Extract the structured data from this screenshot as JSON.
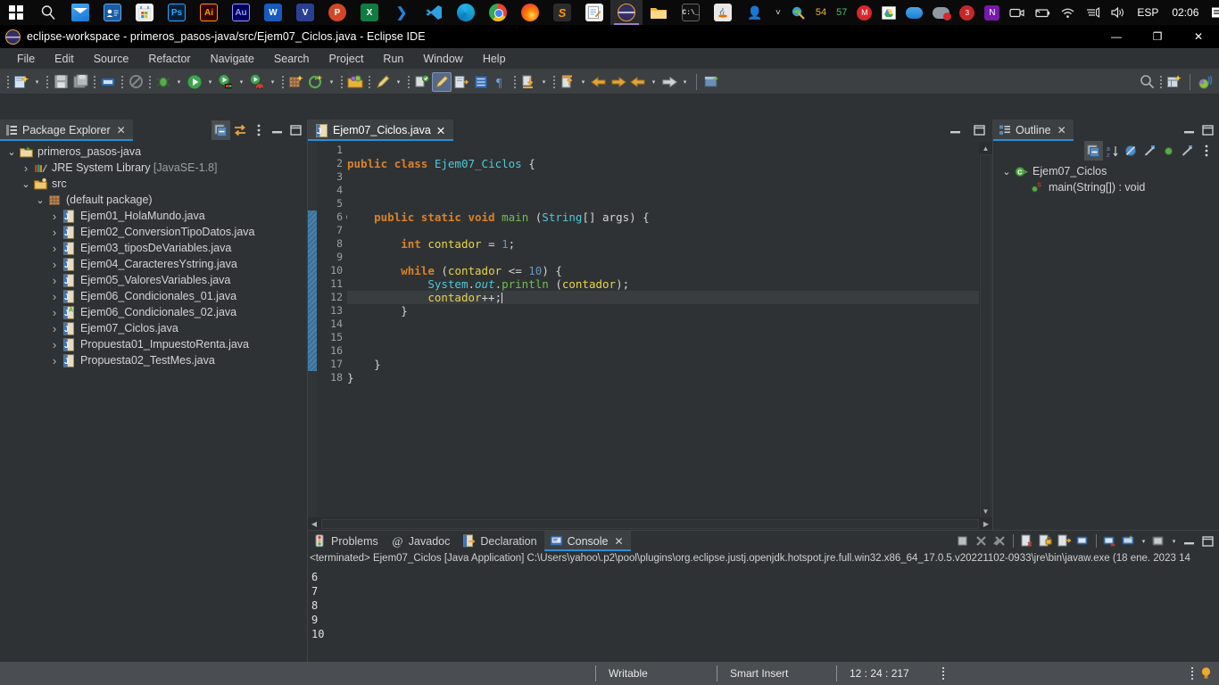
{
  "taskbar": {
    "left_items": [
      {
        "name": "start-button",
        "label": "Start"
      },
      {
        "name": "search-icon",
        "label": "Search"
      },
      {
        "name": "mail-icon",
        "label": "Mail"
      },
      {
        "name": "people-icon",
        "label": "People"
      },
      {
        "name": "microsoft-store-icon",
        "label": "Microsoft Store"
      },
      {
        "name": "photoshop-icon",
        "label": "Ps"
      },
      {
        "name": "illustrator-icon",
        "label": "Ai"
      },
      {
        "name": "audition-icon",
        "label": "Au"
      },
      {
        "name": "word-icon",
        "label": "W"
      },
      {
        "name": "visio-icon",
        "label": "V"
      },
      {
        "name": "powerpoint-icon",
        "label": "P"
      },
      {
        "name": "excel-icon",
        "label": "X"
      },
      {
        "name": "chevron-right-icon",
        "label": ""
      },
      {
        "name": "vscode-icon",
        "label": ""
      },
      {
        "name": "edge-icon",
        "label": ""
      },
      {
        "name": "chrome-icon",
        "label": ""
      },
      {
        "name": "firefox-icon",
        "label": ""
      },
      {
        "name": "sublime-icon",
        "label": ""
      },
      {
        "name": "notepad-icon",
        "label": ""
      },
      {
        "name": "eclipse-icon",
        "label": ""
      },
      {
        "name": "file-explorer-icon",
        "label": ""
      },
      {
        "name": "command-prompt-icon",
        "label": "C:\\"
      },
      {
        "name": "java-icon",
        "label": ""
      },
      {
        "name": "teams-people-icon",
        "label": ""
      }
    ],
    "tray": {
      "chevron_up": "˅",
      "counter_yellow": "54",
      "counter_green": "57",
      "language": "ESP",
      "clock": "02:06"
    }
  },
  "window": {
    "title": "eclipse-workspace - primeros_pasos-java/src/Ejem07_Ciclos.java - Eclipse IDE",
    "controls": {
      "minimize": "—",
      "maximize": "❐",
      "close": "✕"
    }
  },
  "menu": {
    "items": [
      "File",
      "Edit",
      "Source",
      "Refactor",
      "Navigate",
      "Search",
      "Project",
      "Run",
      "Window",
      "Help"
    ]
  },
  "package_explorer": {
    "tab_label": "Package Explorer",
    "close_label": "✕",
    "tree": [
      {
        "label": "primeros_pasos-java",
        "indent": 0,
        "twisty": "v",
        "icon": "project-icon",
        "color": "#d4d4d4"
      },
      {
        "label": "JRE System Library [JavaSE-1.8]",
        "indent": 1,
        "twisty": ">",
        "icon": "library-icon",
        "color": "#d4d4d4"
      },
      {
        "label": "src",
        "indent": 1,
        "twisty": "v",
        "icon": "source-folder-icon",
        "color": "#d4d4d4"
      },
      {
        "label": "(default package)",
        "indent": 2,
        "twisty": "v",
        "icon": "package-icon",
        "color": "#d4d4d4"
      },
      {
        "label": "Ejem01_HolaMundo.java",
        "indent": 3,
        "twisty": ">",
        "icon": "java-file-icon",
        "color": "#d4d4d4"
      },
      {
        "label": "Ejem02_ConversionTipoDatos.java",
        "indent": 3,
        "twisty": ">",
        "icon": "java-file-icon",
        "color": "#d4d4d4"
      },
      {
        "label": "Ejem03_tiposDeVariables.java",
        "indent": 3,
        "twisty": ">",
        "icon": "java-file-icon",
        "color": "#d4d4d4"
      },
      {
        "label": "Ejem04_CaracteresYstring.java",
        "indent": 3,
        "twisty": ">",
        "icon": "java-file-icon",
        "color": "#d4d4d4"
      },
      {
        "label": "Ejem05_ValoresVariables.java",
        "indent": 3,
        "twisty": ">",
        "icon": "java-file-icon",
        "color": "#d4d4d4"
      },
      {
        "label": "Ejem06_Condicionales_01.java",
        "indent": 3,
        "twisty": ">",
        "icon": "java-file-icon",
        "color": "#d4d4d4"
      },
      {
        "label": "Ejem06_Condicionales_02.java",
        "indent": 3,
        "twisty": ">",
        "icon": "java-file-warning-icon",
        "color": "#d4d4d4"
      },
      {
        "label": "Ejem07_Ciclos.java",
        "indent": 3,
        "twisty": ">",
        "icon": "java-file-icon",
        "color": "#d4d4d4"
      },
      {
        "label": "Propuesta01_ImpuestoRenta.java",
        "indent": 3,
        "twisty": ">",
        "icon": "java-file-icon",
        "color": "#d4d4d4"
      },
      {
        "label": "Propuesta02_TestMes.java",
        "indent": 3,
        "twisty": ">",
        "icon": "java-file-icon",
        "color": "#d4d4d4"
      }
    ]
  },
  "editor": {
    "tab_label": "Ejem07_Ciclos.java",
    "tab_close": "✕",
    "lines": [
      {
        "n": "1",
        "text": "",
        "highlight": false,
        "changed": false,
        "fold": false
      },
      {
        "n": "2",
        "text": "public class Ejem07_Ciclos {",
        "highlight": false,
        "changed": false,
        "fold": false
      },
      {
        "n": "3",
        "text": "",
        "highlight": false,
        "changed": false,
        "fold": false
      },
      {
        "n": "4",
        "text": "",
        "highlight": false,
        "changed": false,
        "fold": false
      },
      {
        "n": "5",
        "text": "",
        "highlight": false,
        "changed": false,
        "fold": false
      },
      {
        "n": "6",
        "text": "    public static void main (String[] args) {",
        "highlight": false,
        "changed": true,
        "fold": true
      },
      {
        "n": "7",
        "text": "",
        "highlight": false,
        "changed": true,
        "fold": false
      },
      {
        "n": "8",
        "text": "        int contador = 1;",
        "highlight": false,
        "changed": true,
        "fold": false
      },
      {
        "n": "9",
        "text": "",
        "highlight": false,
        "changed": true,
        "fold": false
      },
      {
        "n": "10",
        "text": "        while (contador <= 10) {",
        "highlight": false,
        "changed": true,
        "fold": false
      },
      {
        "n": "11",
        "text": "            System.out.println (contador);",
        "highlight": false,
        "changed": true,
        "fold": false
      },
      {
        "n": "12",
        "text": "            contador++;",
        "highlight": true,
        "changed": true,
        "fold": false
      },
      {
        "n": "13",
        "text": "        }",
        "highlight": false,
        "changed": true,
        "fold": false
      },
      {
        "n": "14",
        "text": "",
        "highlight": false,
        "changed": true,
        "fold": false
      },
      {
        "n": "15",
        "text": "",
        "highlight": false,
        "changed": true,
        "fold": false
      },
      {
        "n": "16",
        "text": "",
        "highlight": false,
        "changed": true,
        "fold": false
      },
      {
        "n": "17",
        "text": "    }",
        "highlight": false,
        "changed": true,
        "fold": false
      },
      {
        "n": "18",
        "text": "}",
        "highlight": false,
        "changed": false,
        "fold": false
      }
    ],
    "syntax_colors": {
      "keyword": "#d9822b",
      "type": "#4ec9d8",
      "method": "#6fbf4f",
      "variable": "#e8d44d",
      "number": "#6897bb",
      "plain": "#d4d4d4",
      "line_highlight": "#3a3d40",
      "background": "#2f3234"
    }
  },
  "outline": {
    "tab_label": "Outline",
    "close_label": "✕",
    "tree": [
      {
        "label": "Ejem07_Ciclos",
        "indent": 0,
        "twisty": "v",
        "icon": "class-icon"
      },
      {
        "label": "main(String[]) : void",
        "indent": 1,
        "twisty": "",
        "icon": "method-static-icon"
      }
    ]
  },
  "console": {
    "tabs": [
      {
        "label": "Problems",
        "icon": "problems-icon",
        "active": false
      },
      {
        "label": "Javadoc",
        "icon": "javadoc-icon",
        "active": false
      },
      {
        "label": "Declaration",
        "icon": "declaration-icon",
        "active": false
      },
      {
        "label": "Console",
        "icon": "console-icon",
        "active": true
      }
    ],
    "close_label": "✕",
    "header": "<terminated> Ejem07_Ciclos [Java Application] C:\\Users\\yahoo\\.p2\\pool\\plugins\\org.eclipse.justj.openjdk.hotspot.jre.full.win32.x86_64_17.0.5.v20221102-0933\\jre\\bin\\javaw.exe  (18 ene. 2023 14",
    "output": [
      "6",
      "7",
      "8",
      "9",
      "10"
    ]
  },
  "status_bar": {
    "writable": "Writable",
    "insert_mode": "Smart Insert",
    "position": "12 : 24 : 217"
  }
}
